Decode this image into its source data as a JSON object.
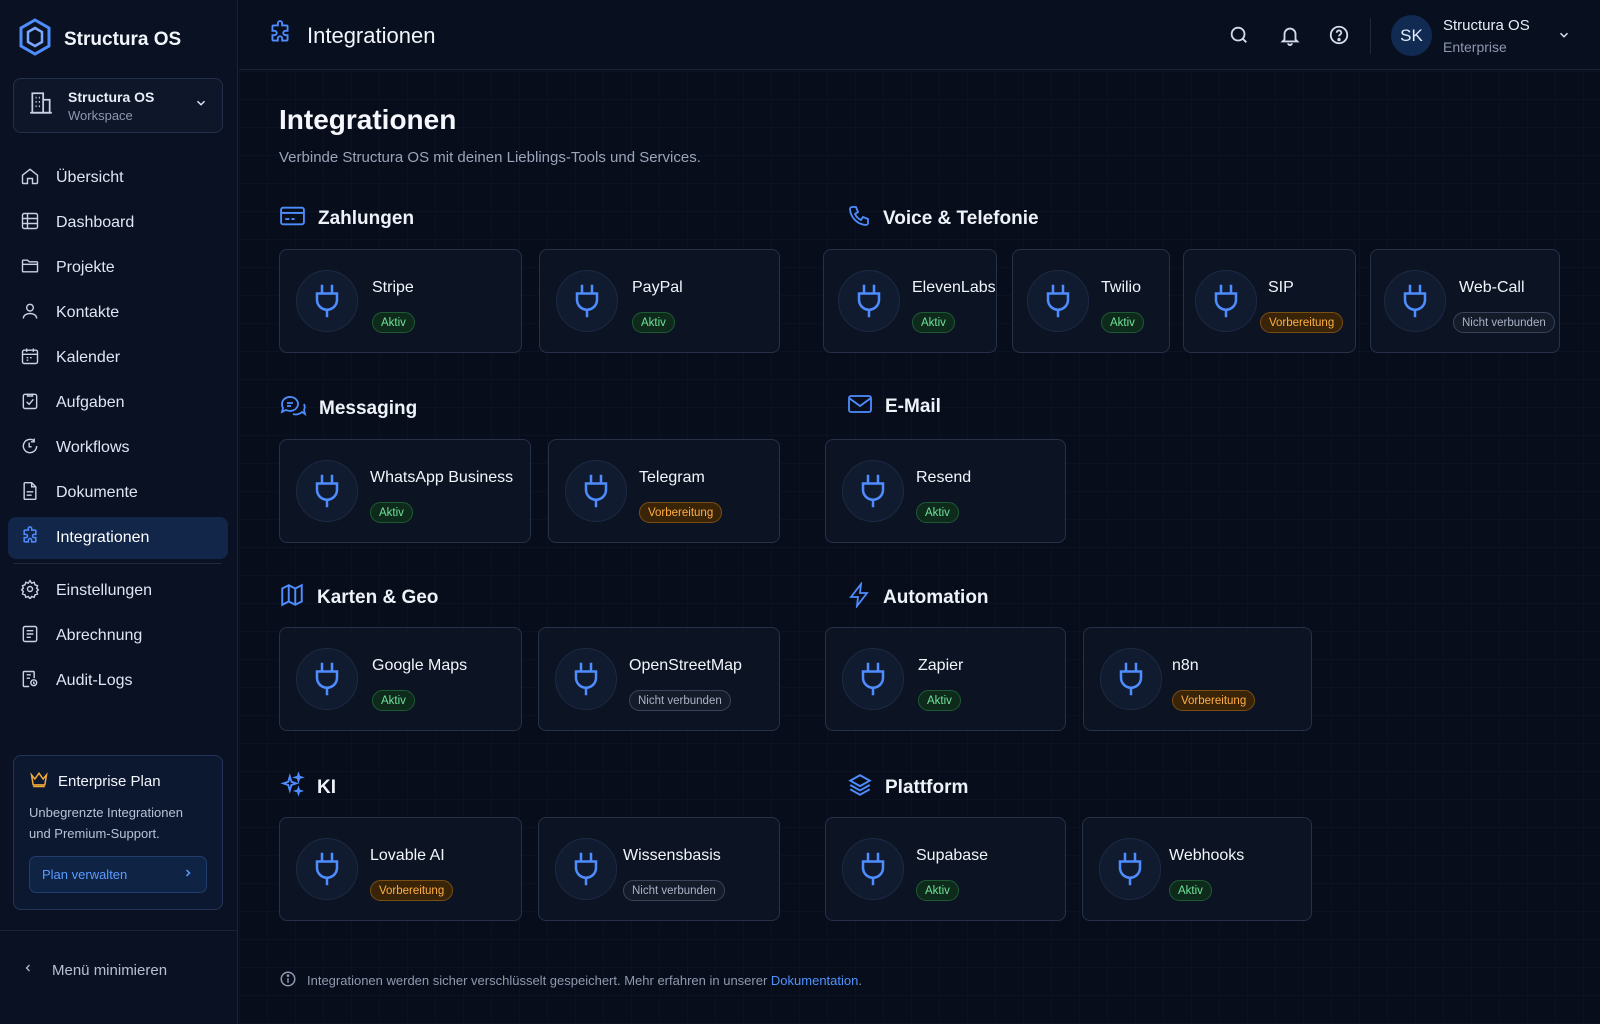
{
  "brand": {
    "name": "Structura OS"
  },
  "workspace": {
    "title": "Structura OS",
    "subtitle": "Workspace"
  },
  "nav": {
    "items": [
      {
        "label": "Übersicht",
        "icon": "home-icon"
      },
      {
        "label": "Dashboard",
        "icon": "grid-icon"
      },
      {
        "label": "Projekte",
        "icon": "folder-icon"
      },
      {
        "label": "Kontakte",
        "icon": "user-icon"
      },
      {
        "label": "Kalender",
        "icon": "calendar-icon"
      },
      {
        "label": "Aufgaben",
        "icon": "task-check-icon"
      },
      {
        "label": "Workflows",
        "icon": "workflow-icon"
      },
      {
        "label": "Dokumente",
        "icon": "document-icon"
      },
      {
        "label": "Integrationen",
        "icon": "puzzle-icon",
        "active": true
      }
    ],
    "secondary": [
      {
        "label": "Einstellungen",
        "icon": "gear-icon"
      },
      {
        "label": "Abrechnung",
        "icon": "billing-icon"
      },
      {
        "label": "Audit-Logs",
        "icon": "audit-icon"
      }
    ]
  },
  "plan": {
    "title": "Enterprise Plan",
    "description": "Unbegrenzte Integrationen und Premium-Support.",
    "button": "Plan verwalten"
  },
  "minimize": "Menü minimieren",
  "topbar": {
    "title": "Integrationen"
  },
  "user": {
    "initials": "SK",
    "name": "Structura OS",
    "plan": "Enterprise"
  },
  "page": {
    "title": "Integrationen",
    "subtitle": "Verbinde Structura OS mit deinen Lieblings-Tools und Services."
  },
  "sections": {
    "zahlungen": {
      "title": "Zahlungen",
      "cards": [
        {
          "name": "Stripe",
          "status": "Aktiv"
        },
        {
          "name": "PayPal",
          "status": "Aktiv"
        }
      ]
    },
    "voice": {
      "title": "Voice & Telefonie",
      "cards": [
        {
          "name": "ElevenLabs",
          "status": "Aktiv"
        },
        {
          "name": "Twilio",
          "status": "Aktiv"
        },
        {
          "name": "SIP",
          "status": "Vorbereitung"
        },
        {
          "name": "Web-Call",
          "status": "Nicht verbunden"
        }
      ]
    },
    "messaging": {
      "title": "Messaging",
      "cards": [
        {
          "name": "WhatsApp Business",
          "status": "Aktiv"
        },
        {
          "name": "Telegram",
          "status": "Vorbereitung"
        }
      ]
    },
    "email": {
      "title": "E-Mail",
      "cards": [
        {
          "name": "Resend",
          "status": "Aktiv"
        }
      ]
    },
    "karten": {
      "title": "Karten & Geo",
      "cards": [
        {
          "name": "Google Maps",
          "status": "Aktiv"
        },
        {
          "name": "OpenStreetMap",
          "status": "Nicht verbunden"
        }
      ]
    },
    "automation": {
      "title": "Automation",
      "cards": [
        {
          "name": "Zapier",
          "status": "Aktiv"
        },
        {
          "name": "n8n",
          "status": "Vorbereitung"
        }
      ]
    },
    "ki": {
      "title": "KI",
      "cards": [
        {
          "name": "Lovable AI",
          "status": "Vorbereitung"
        },
        {
          "name": "Wissensbasis",
          "status": "Nicht verbunden"
        }
      ]
    },
    "plattform": {
      "title": "Plattform",
      "cards": [
        {
          "name": "Supabase",
          "status": "Aktiv"
        },
        {
          "name": "Webhooks",
          "status": "Aktiv"
        }
      ]
    }
  },
  "footer": {
    "text": "Integrationen werden sicher verschlüsselt gespeichert. Mehr erfahren in unserer",
    "link": "Dokumentation",
    "end": "."
  },
  "colors": {
    "accent": "#4f8dff",
    "active_green": "#6fe29a",
    "prep_orange": "#ffae45"
  }
}
